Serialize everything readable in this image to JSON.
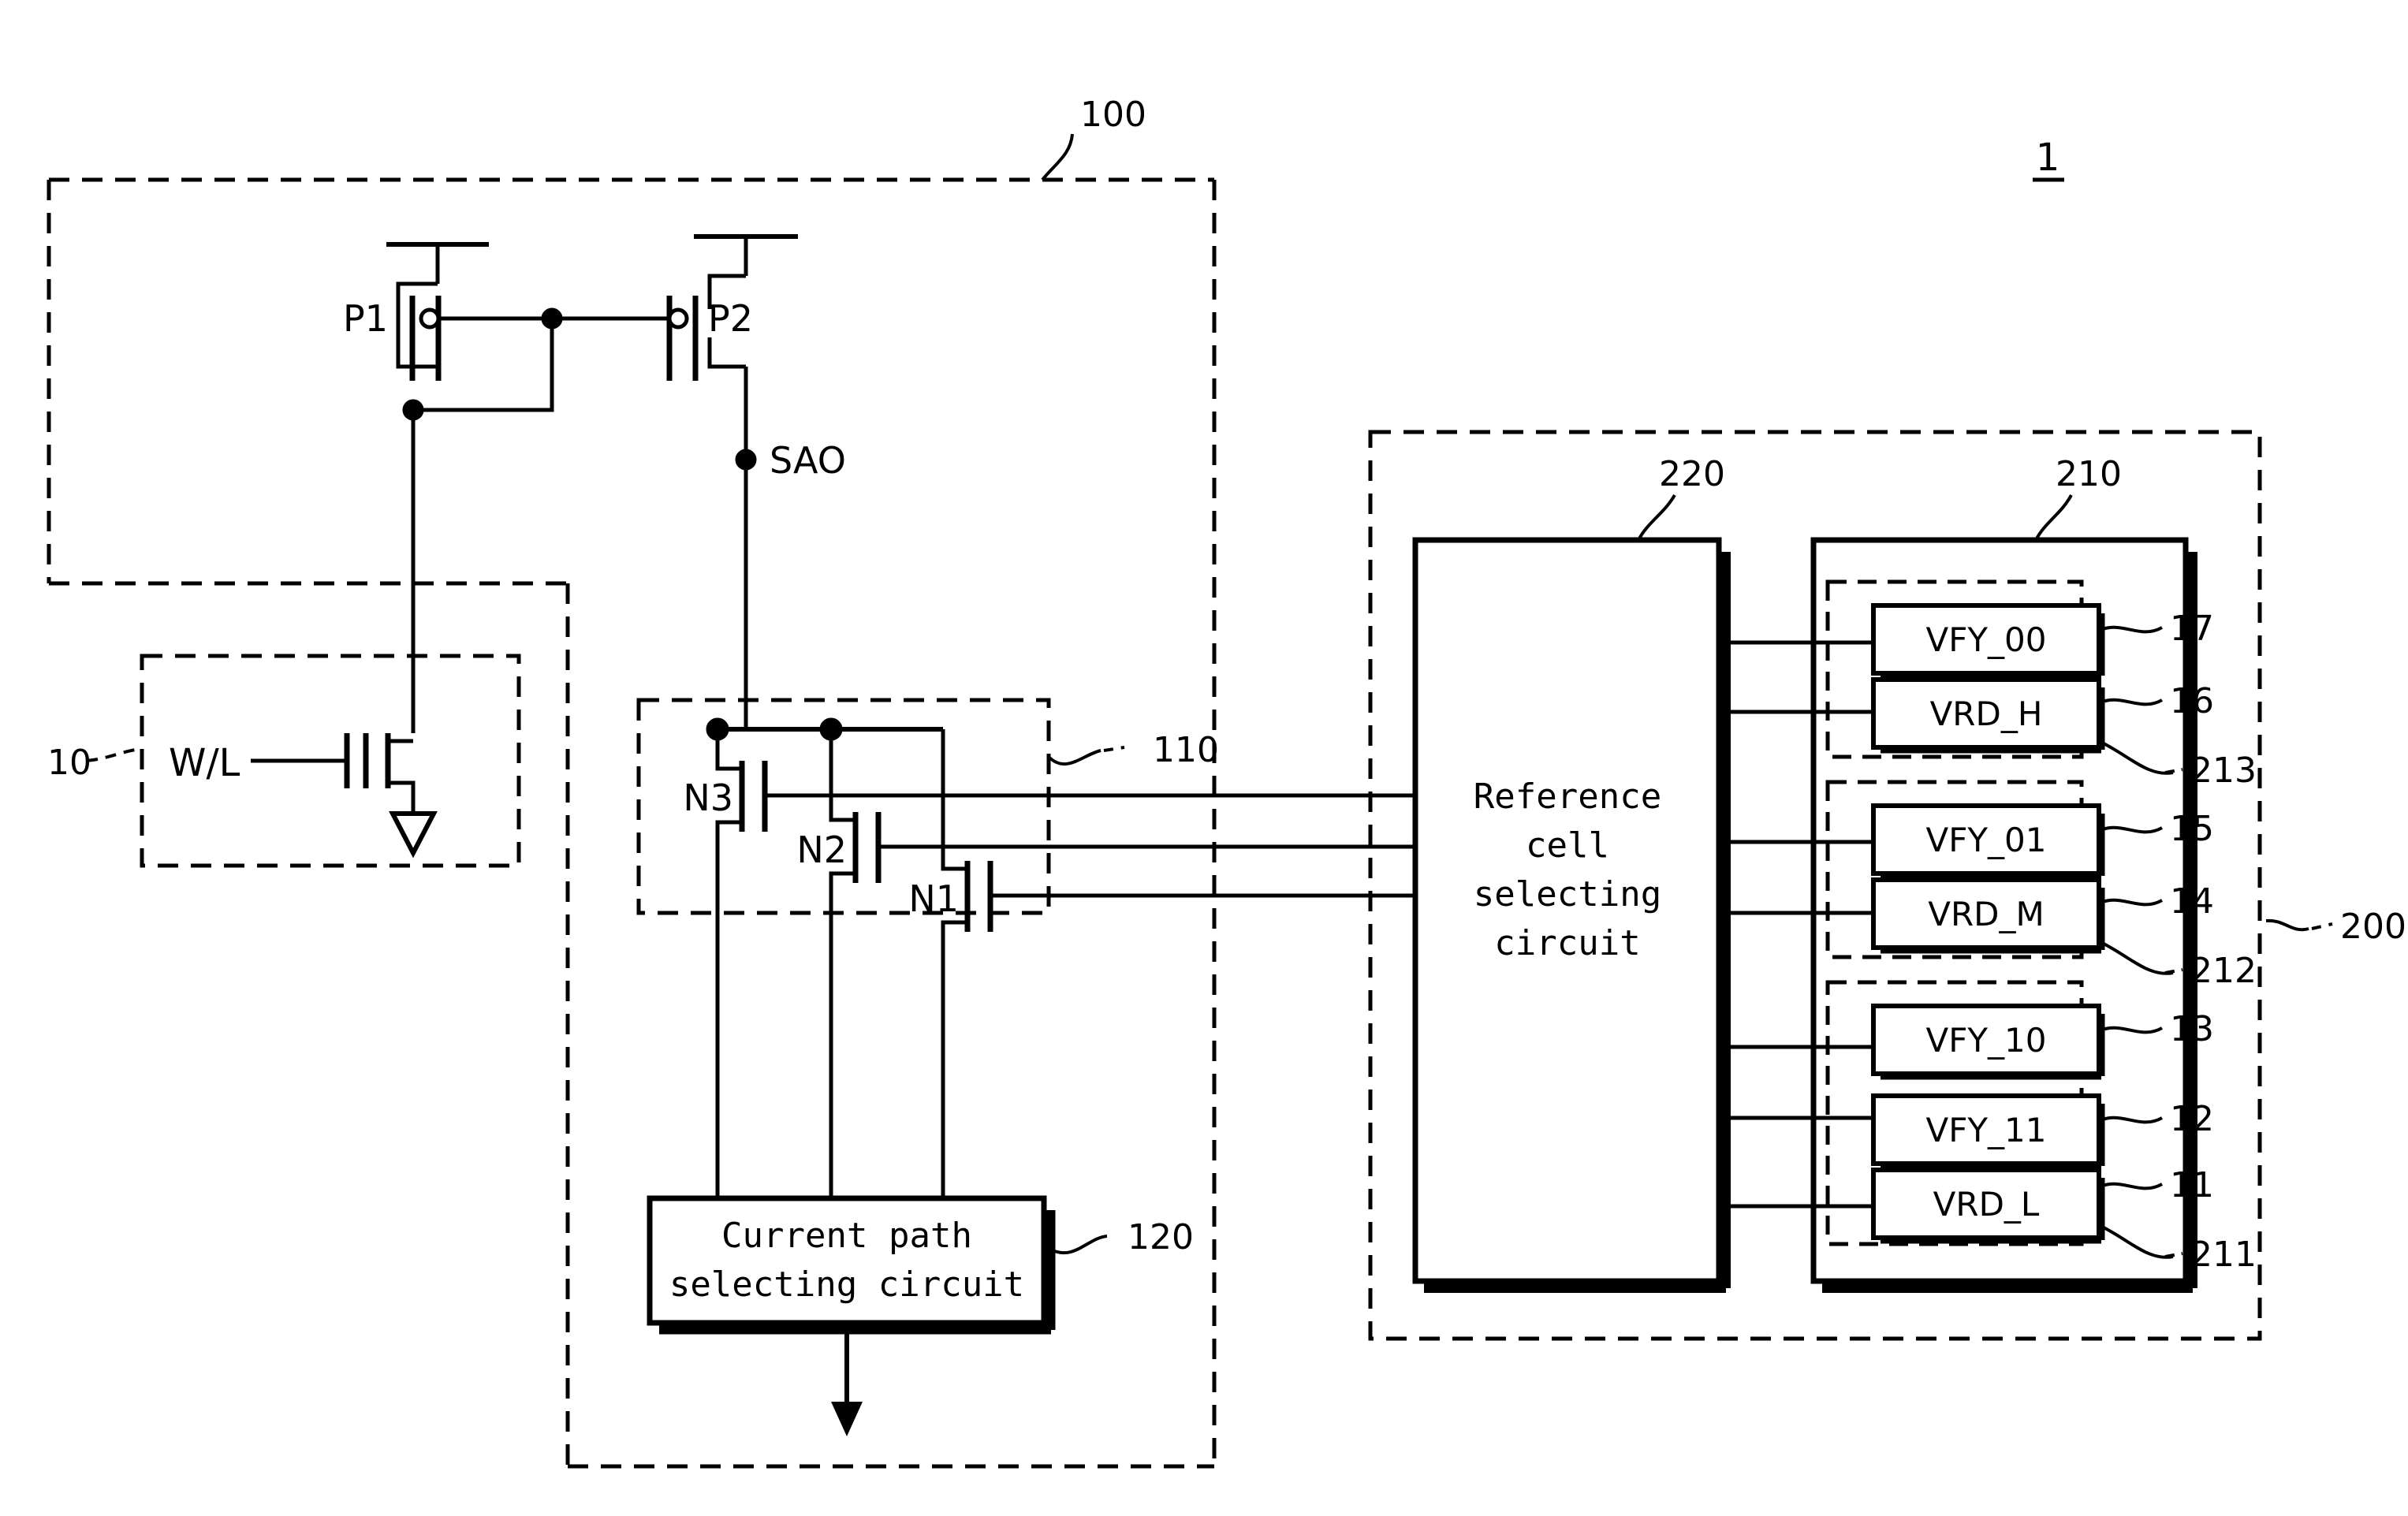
{
  "figure": {
    "number": "1"
  },
  "labels": {
    "ref_100": "100",
    "ref_110": "110",
    "ref_120": "120",
    "ref_10": "10",
    "ref_200": "200",
    "ref_210": "210",
    "ref_220": "220",
    "ref_211": "211",
    "ref_212": "212",
    "ref_213": "213",
    "ref_11": "11",
    "ref_12": "12",
    "ref_13": "13",
    "ref_14": "14",
    "ref_15": "15",
    "ref_16": "16",
    "ref_17": "17"
  },
  "sense_amp": {
    "p1": "P1",
    "p2": "P2",
    "sao": "SAO",
    "n1": "N1",
    "n2": "N2",
    "n3": "N3",
    "current_path_line1": "Current path",
    "current_path_line2": "selecting circuit"
  },
  "memory_cell": {
    "wl": "W/L"
  },
  "reference_block": {
    "selector_line1": "Reference",
    "selector_line2": "cell",
    "selector_line3": "selecting",
    "selector_line4": "circuit",
    "cells": [
      {
        "label": "VFY_00",
        "ref": "17"
      },
      {
        "label": "VRD_H",
        "ref": "16"
      },
      {
        "label": "VFY_01",
        "ref": "15"
      },
      {
        "label": "VRD_M",
        "ref": "14"
      },
      {
        "label": "VFY_10",
        "ref": "13"
      },
      {
        "label": "VFY_11",
        "ref": "12"
      },
      {
        "label": "VRD_L",
        "ref": "11"
      }
    ],
    "groups": [
      {
        "ref": "213"
      },
      {
        "ref": "212"
      },
      {
        "ref": "211"
      }
    ]
  },
  "colors": {
    "ink": "#000000",
    "paper": "#ffffff"
  }
}
